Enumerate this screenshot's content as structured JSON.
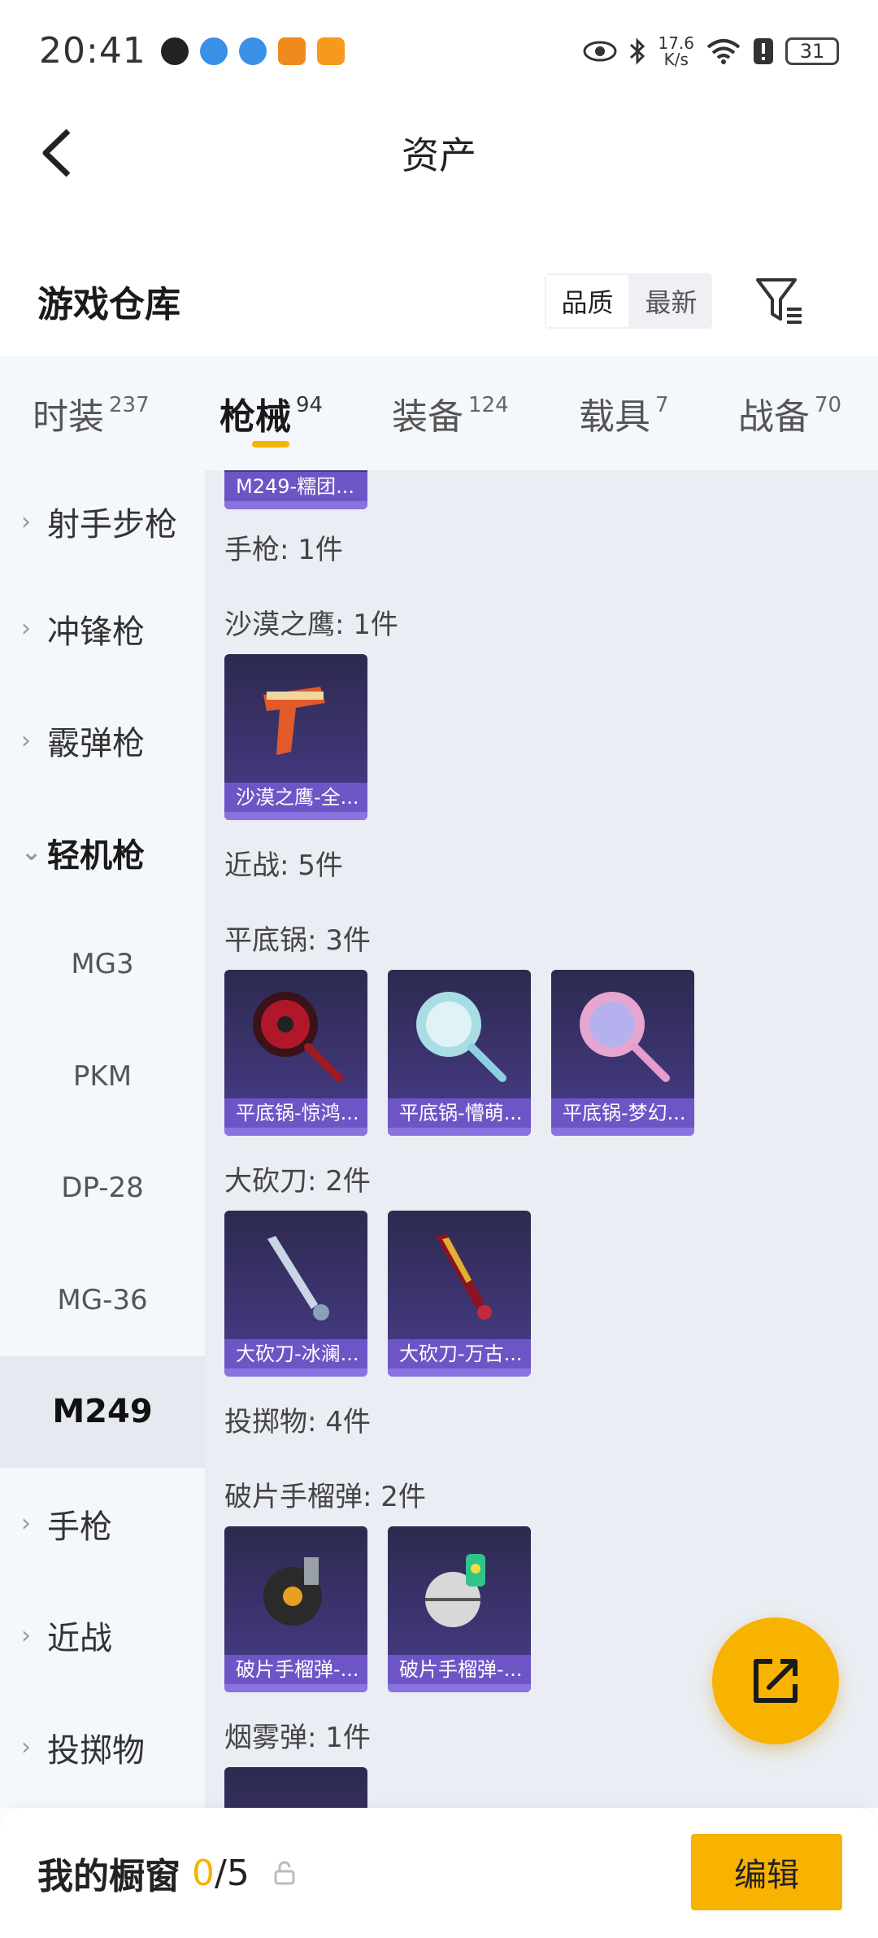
{
  "status_bar": {
    "time": "20:41",
    "net_speed_value": "17.6",
    "net_speed_unit": "K/s",
    "battery": "31"
  },
  "header": {
    "title": "资产"
  },
  "warehouse": {
    "title": "游戏仓库",
    "sort_options": [
      "品质",
      "最新"
    ],
    "active_sort": "品质"
  },
  "tabs": [
    {
      "label": "时装",
      "count": "237"
    },
    {
      "label": "枪械",
      "count": "94",
      "active": true
    },
    {
      "label": "装备",
      "count": "124"
    },
    {
      "label": "载具",
      "count": "7"
    },
    {
      "label": "战备",
      "count": "70"
    }
  ],
  "sidebar": {
    "categories": {
      "rifle": "射手步枪",
      "smg": "冲锋枪",
      "shotgun": "霰弹枪",
      "lmg": "轻机枪",
      "pistol": "手枪",
      "melee": "近战",
      "throwable": "投掷物"
    },
    "lmg_children": [
      "MG3",
      "PKM",
      "DP-28",
      "MG-36",
      "M249"
    ],
    "active_child": "M249"
  },
  "content": {
    "top_partial_item": "M249-糯团...",
    "groups": {
      "pistol_total": "手枪: 1件",
      "deagle": "沙漠之鹰: 1件",
      "melee_total": "近战: 5件",
      "pan": "平底锅: 3件",
      "machete": "大砍刀: 2件",
      "throw_total": "投掷物: 4件",
      "frag": "破片手榴弹: 2件",
      "smoke": "烟雾弹: 1件"
    },
    "items": {
      "deagle_1": "沙漠之鹰-全...",
      "pan_1": "平底锅-惊鸿...",
      "pan_2": "平底锅-懵萌...",
      "pan_3": "平底锅-梦幻...",
      "machete_1": "大砍刀-冰澜...",
      "machete_2": "大砍刀-万古...",
      "frag_1": "破片手榴弹-...",
      "frag_2": "破片手榴弹-..."
    }
  },
  "showcase": {
    "label": "我的橱窗",
    "current": "0",
    "max": "/5",
    "edit_label": "编辑"
  },
  "colors": {
    "accent": "#f5b400",
    "card_bg": "#3d3573",
    "card_label": "#6d55c6",
    "panel_bg": "#eaedf3",
    "sidebar_bg": "#f4f7fb"
  }
}
